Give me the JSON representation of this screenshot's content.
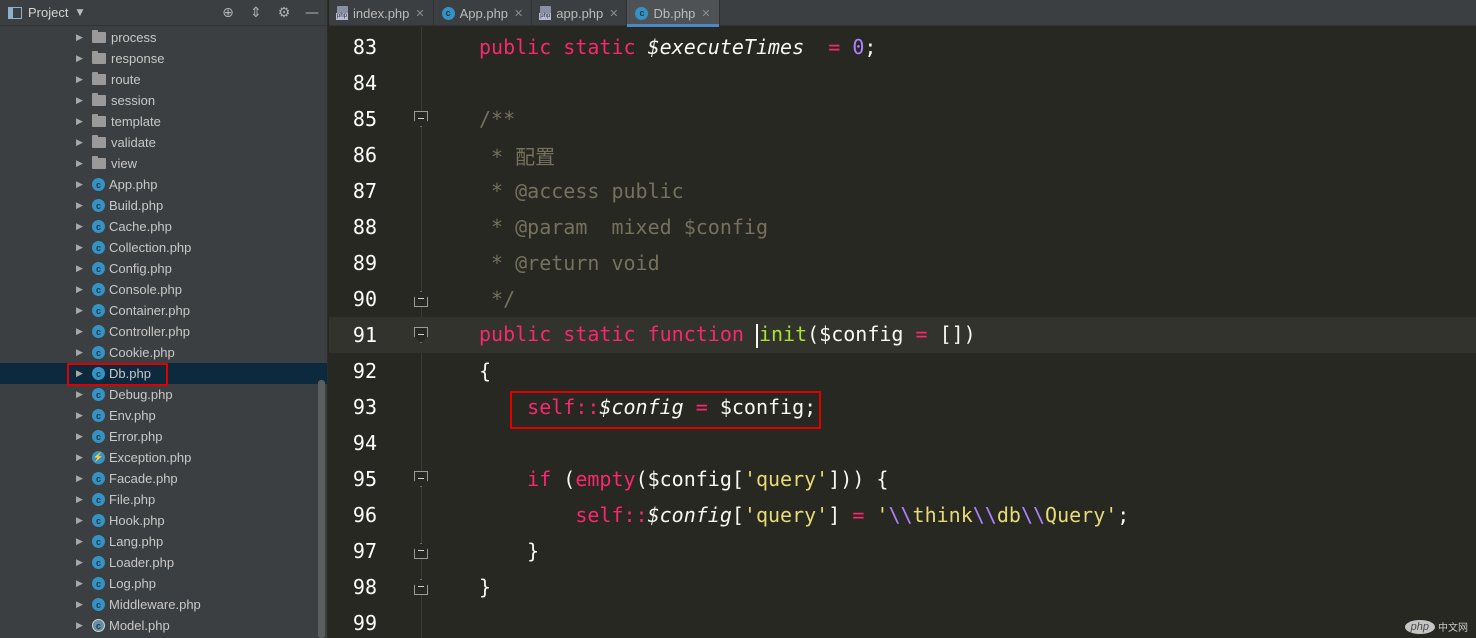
{
  "project_panel": {
    "title": "Project",
    "tree": [
      {
        "label": "process",
        "type": "folder"
      },
      {
        "label": "response",
        "type": "folder"
      },
      {
        "label": "route",
        "type": "folder"
      },
      {
        "label": "session",
        "type": "folder"
      },
      {
        "label": "template",
        "type": "folder"
      },
      {
        "label": "validate",
        "type": "folder"
      },
      {
        "label": "view",
        "type": "folder"
      },
      {
        "label": "App.php",
        "type": "class"
      },
      {
        "label": "Build.php",
        "type": "class"
      },
      {
        "label": "Cache.php",
        "type": "class"
      },
      {
        "label": "Collection.php",
        "type": "class"
      },
      {
        "label": "Config.php",
        "type": "class"
      },
      {
        "label": "Console.php",
        "type": "class"
      },
      {
        "label": "Container.php",
        "type": "class"
      },
      {
        "label": "Controller.php",
        "type": "class"
      },
      {
        "label": "Cookie.php",
        "type": "class"
      },
      {
        "label": "Db.php",
        "type": "class",
        "selected": true
      },
      {
        "label": "Debug.php",
        "type": "class"
      },
      {
        "label": "Env.php",
        "type": "class"
      },
      {
        "label": "Error.php",
        "type": "class"
      },
      {
        "label": "Exception.php",
        "type": "exception"
      },
      {
        "label": "Facade.php",
        "type": "class"
      },
      {
        "label": "File.php",
        "type": "class"
      },
      {
        "label": "Hook.php",
        "type": "class"
      },
      {
        "label": "Lang.php",
        "type": "class"
      },
      {
        "label": "Loader.php",
        "type": "class"
      },
      {
        "label": "Log.php",
        "type": "class"
      },
      {
        "label": "Middleware.php",
        "type": "class"
      },
      {
        "label": "Model.php",
        "type": "abstract"
      }
    ]
  },
  "tabs": [
    {
      "label": "index.php",
      "icon": "php-file-icon",
      "active": false
    },
    {
      "label": "App.php",
      "icon": "class-icon",
      "active": false
    },
    {
      "label": "app.php",
      "icon": "php-file-icon",
      "active": false
    },
    {
      "label": "Db.php",
      "icon": "class-icon",
      "active": true
    }
  ],
  "editor": {
    "lines": [
      {
        "n": "83",
        "tokens": [
          [
            "kw",
            "public static "
          ],
          [
            "var",
            "$executeTimes"
          ],
          [
            "",
            "  "
          ],
          [
            "kw",
            "="
          ],
          [
            "",
            " "
          ],
          [
            "num",
            "0"
          ],
          [
            "",
            ";"
          ]
        ]
      },
      {
        "n": "84",
        "tokens": []
      },
      {
        "n": "85",
        "fold": "open",
        "tokens": [
          [
            "cmt",
            "/**"
          ]
        ]
      },
      {
        "n": "86",
        "tokens": [
          [
            "cmt",
            " * 配置"
          ]
        ]
      },
      {
        "n": "87",
        "tokens": [
          [
            "cmt",
            " * @access public"
          ]
        ]
      },
      {
        "n": "88",
        "tokens": [
          [
            "cmt",
            " * @param  mixed $config"
          ]
        ]
      },
      {
        "n": "89",
        "tokens": [
          [
            "cmt",
            " * @return void"
          ]
        ]
      },
      {
        "n": "90",
        "fold": "close",
        "tokens": [
          [
            "cmt",
            " */"
          ]
        ]
      },
      {
        "n": "91",
        "fold": "open",
        "current": true,
        "tokens": [
          [
            "kw",
            "public static function "
          ],
          [
            "caret",
            ""
          ],
          [
            "fn",
            "init"
          ],
          [
            "",
            "($config "
          ],
          [
            "kw",
            "="
          ],
          [
            "",
            " [])"
          ]
        ]
      },
      {
        "n": "92",
        "tokens": [
          [
            "",
            "{"
          ]
        ]
      },
      {
        "n": "93",
        "tokens": [
          [
            "",
            "    "
          ],
          [
            "kw",
            "self::"
          ],
          [
            "var",
            "$config"
          ],
          [
            "",
            " "
          ],
          [
            "kw",
            "="
          ],
          [
            "",
            " $config;"
          ]
        ]
      },
      {
        "n": "94",
        "tokens": []
      },
      {
        "n": "95",
        "fold": "open",
        "tokens": [
          [
            "",
            "    "
          ],
          [
            "kw",
            "if "
          ],
          [
            "",
            "("
          ],
          [
            "kw",
            "empty"
          ],
          [
            "",
            "($config["
          ],
          [
            "str",
            "'query'"
          ],
          [
            "",
            "])) {"
          ]
        ]
      },
      {
        "n": "96",
        "tokens": [
          [
            "",
            "        "
          ],
          [
            "kw",
            "self::"
          ],
          [
            "var",
            "$config"
          ],
          [
            "",
            "["
          ],
          [
            "str",
            "'query'"
          ],
          [
            "",
            "] "
          ],
          [
            "kw",
            "="
          ],
          [
            "",
            " "
          ],
          [
            "str",
            "'"
          ],
          [
            "esc",
            "\\\\"
          ],
          [
            "str",
            "think"
          ],
          [
            "esc",
            "\\\\"
          ],
          [
            "str",
            "db"
          ],
          [
            "esc",
            "\\\\"
          ],
          [
            "str",
            "Query'"
          ],
          [
            "",
            ";"
          ]
        ]
      },
      {
        "n": "97",
        "fold": "close",
        "tokens": [
          [
            "",
            "    }"
          ]
        ]
      },
      {
        "n": "98",
        "fold": "close",
        "tokens": [
          [
            "",
            "}"
          ]
        ]
      },
      {
        "n": "99",
        "tokens": []
      }
    ]
  },
  "watermark": {
    "logo": "php",
    "text": "中文网"
  }
}
